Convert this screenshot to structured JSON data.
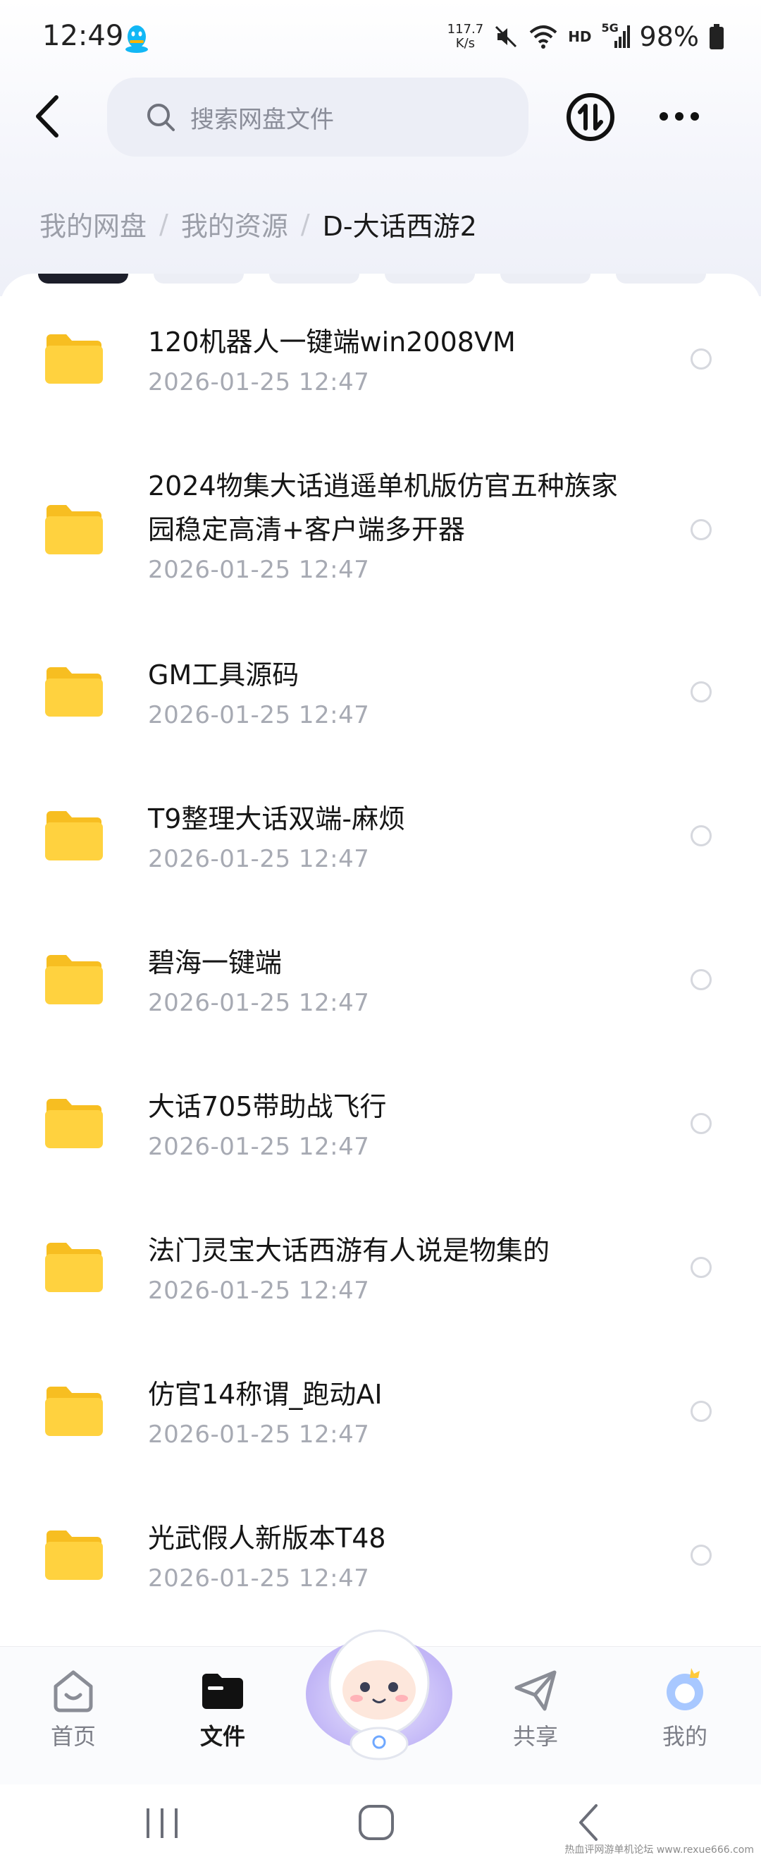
{
  "status_bar": {
    "time": "12:49",
    "net_speed_value": "117.7",
    "net_speed_unit": "K/s",
    "network_badge": "HD",
    "signal_badge": "5G",
    "battery": "98%"
  },
  "header": {
    "search_placeholder": "搜索网盘文件"
  },
  "breadcrumb": {
    "items": [
      "我的网盘",
      "我的资源"
    ],
    "separator": "/",
    "current": "D-大话西游2"
  },
  "files": [
    {
      "name": "120机器人一键端win2008VM",
      "date": "2026-01-25  12:47"
    },
    {
      "name": "2024物集大话逍遥单机版仿官五种族家",
      "name_line2": "园稳定高清+客户端多开器",
      "date": "2026-01-25  12:47"
    },
    {
      "name": "GM工具源码",
      "date": "2026-01-25  12:47"
    },
    {
      "name": "T9整理大话双端-麻烦",
      "date": "2026-01-25  12:47"
    },
    {
      "name": "碧海一键端",
      "date": "2026-01-25  12:47"
    },
    {
      "name": "大话705带助战飞行",
      "date": "2026-01-25  12:47"
    },
    {
      "name": "法门灵宝大话西游有人说是物集的",
      "date": "2026-01-25  12:47"
    },
    {
      "name": "仿官14称谓_跑动AI",
      "date": "2026-01-25  12:47"
    },
    {
      "name": "光武假人新版本T48",
      "date": "2026-01-25  12:47"
    }
  ],
  "bottom_nav": {
    "home": "首页",
    "files": "文件",
    "share": "共享",
    "mine": "我的"
  },
  "watermark": "热血评网游单机论坛 www.rexue666.com",
  "colors": {
    "folder_yellow": "#FFD23F",
    "accent_blue": "#6FA8FF",
    "text_primary": "#151515",
    "text_secondary": "#A7AAB3"
  },
  "icons": {
    "qq": "qq-penguin-icon",
    "back": "chevron-left-icon",
    "search": "search-icon",
    "transfer": "transfer-icon",
    "more": "more-dots-icon",
    "folder": "folder-icon",
    "home": "home-icon",
    "files": "folder-tab-icon",
    "share": "paper-plane-icon",
    "mine": "avatar-crown-icon"
  }
}
